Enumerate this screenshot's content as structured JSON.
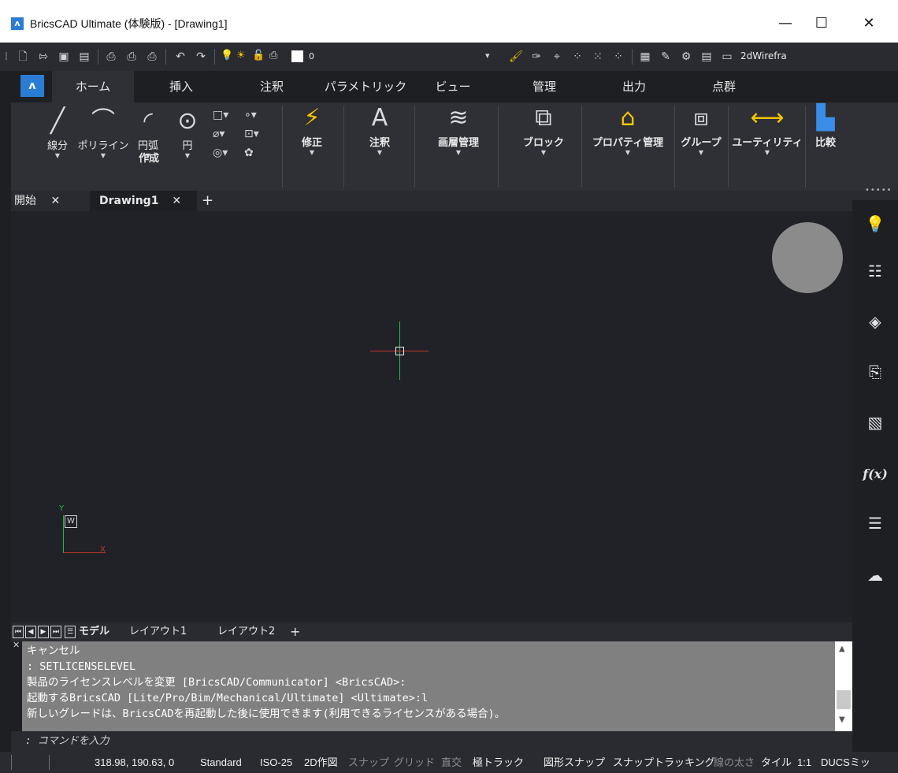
{
  "window": {
    "title": "BricsCAD Ultimate (体験版) - [Drawing1]",
    "minimize": "—",
    "maximize": "☐",
    "close": "✕"
  },
  "qat": {
    "layer_value": "0",
    "workspace": "2dWirefra"
  },
  "ribbon_tabs": [
    "ホーム",
    "挿入",
    "注釈",
    "パラメトリック",
    "ビュー",
    "管理",
    "出力",
    "点群"
  ],
  "ribbon": {
    "draw_buttons": [
      "線分",
      "ポリライン",
      "円弧",
      "円"
    ],
    "group_label": "作成",
    "panel_buttons": [
      "修正",
      "注釈",
      "画層管理",
      "ブロック",
      "プロパティ管理",
      "グループ",
      "ユーティリティ",
      "比較"
    ]
  },
  "doc_tabs": {
    "start": "開始",
    "drawing": "Drawing1",
    "close": "✕",
    "add": "+"
  },
  "canvas": {
    "ucs_w": "W",
    "ucs_y": "Y",
    "ucs_x": "X"
  },
  "layout_tabs": {
    "model": "モデル",
    "layout1": "レイアウト1",
    "layout2": "レイアウト2",
    "add": "+"
  },
  "command": {
    "history": [
      "キャンセル",
      ": SETLICENSELEVEL",
      "製品のライセンスレベルを変更 [BricsCAD/Communicator] <BricsCAD>:",
      "起動するBricsCAD [Lite/Pro/Bim/Mechanical/Ultimate] <Ultimate>:l",
      "新しいグレードは、BricsCADを再起動した後に使用できます(利用できるライセンスがある場合)。"
    ],
    "prompt": ": コマンドを入力"
  },
  "status": {
    "coords": "318.98, 190.63, 0",
    "items": [
      {
        "label": "Standard",
        "on": true
      },
      {
        "label": "ISO-25",
        "on": true
      },
      {
        "label": "2D作図",
        "on": true
      },
      {
        "label": "スナップ",
        "on": false
      },
      {
        "label": "グリッド",
        "on": false
      },
      {
        "label": "直交",
        "on": false
      },
      {
        "label": "極トラック",
        "on": true
      },
      {
        "label": "図形スナップ",
        "on": true
      },
      {
        "label": "スナップトラッキング",
        "on": true
      },
      {
        "label": "線の太さ",
        "on": false
      },
      {
        "label": "タイル",
        "on": true
      },
      {
        "label": "1:1",
        "on": true
      },
      {
        "label": "DUCSミッ",
        "on": true
      }
    ]
  },
  "colors": {
    "accent": "#2b7cd3",
    "ucs_x": "#c0392b",
    "ucs_y": "#1bbf3a",
    "command_bg": "#808080"
  }
}
